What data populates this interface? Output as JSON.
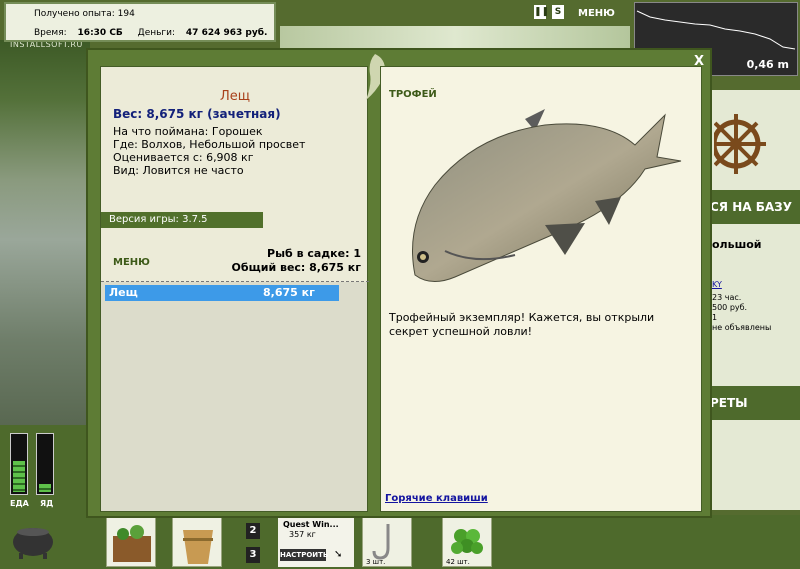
{
  "hud": {
    "exp_label": "Получено опыта:",
    "exp_value": "194",
    "time_label": "Время:",
    "time_value": "16:30 СБ",
    "money_label": "Деньги:",
    "money_value": "47 624 963 руб.",
    "watermark": "INSTALLSOFT.RU",
    "menu_label": "МЕНЮ",
    "pause_icon": "pause-icon",
    "sound_icon": "sound-icon",
    "depth_value": "0,46 m"
  },
  "side_panel": {
    "banner1": "СЯ НА БАЗУ",
    "line_a": "ольшой",
    "line_b": "KY",
    "line_c": "23 час.",
    "line_d": "500 руб.",
    "line_e": "1",
    "line_f": "не объявлены",
    "banner2": "РЕТЫ"
  },
  "gauges": {
    "eat_label": "ЕДА",
    "health_label": "ЯД",
    "eat_level": 0.55,
    "health_level": 0.15
  },
  "inventory": {
    "slot2_num": "2",
    "slot3_num": "3",
    "quest_title": "Quest Win...",
    "quest_weight": "357 кг",
    "quest_button": "НАСТРОИТЬ",
    "hook_qty": "3 шт.",
    "peas_qty": "42 шт."
  },
  "dialog": {
    "close_label": "X",
    "fish_name": "Лещ",
    "weight_line": "Вес: 8,675 кг (зачетная)",
    "details": [
      "На что поймана: Горошек",
      "Где: Волхов, Небольшой просвет",
      "Оценивается с: 6,908 кг",
      "Вид: Ловится не часто"
    ],
    "version": "Версия игры: 3.7.5",
    "menu_label": "МЕНЮ",
    "keep_count": "Рыб в садке: 1",
    "keep_weight": "Общий вес: 8,675 кг",
    "catch_list": [
      {
        "name": "Лещ",
        "weight": "8,675 кг"
      }
    ],
    "trophy_title": "ТРОФЕЙ",
    "trophy_text": "Трофейный экземпляр! Кажется, вы открыли секрет успешной ловли!",
    "hotkeys": "Горячие клавиши"
  },
  "colors": {
    "frame_green": "#5e7c35",
    "panel_cream": "#ecebd8",
    "selection_blue": "#3d9ae8",
    "name_red": "#a8401a",
    "weight_blue": "#13217a"
  }
}
